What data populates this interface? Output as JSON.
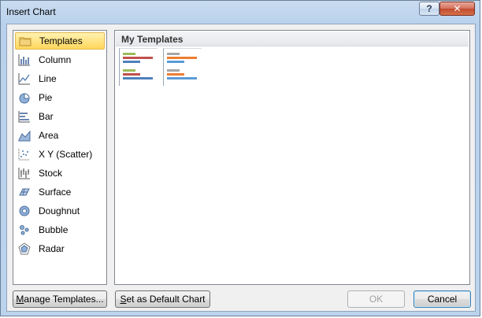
{
  "window": {
    "title": "Insert Chart",
    "help_label": "?",
    "close_label": "✕"
  },
  "chart_types": [
    {
      "label": "Templates",
      "icon": "folder-icon",
      "selected": true
    },
    {
      "label": "Column",
      "icon": "column-chart-icon"
    },
    {
      "label": "Line",
      "icon": "line-chart-icon"
    },
    {
      "label": "Pie",
      "icon": "pie-chart-icon"
    },
    {
      "label": "Bar",
      "icon": "bar-chart-icon"
    },
    {
      "label": "Area",
      "icon": "area-chart-icon"
    },
    {
      "label": "X Y (Scatter)",
      "icon": "scatter-chart-icon"
    },
    {
      "label": "Stock",
      "icon": "stock-chart-icon"
    },
    {
      "label": "Surface",
      "icon": "surface-chart-icon"
    },
    {
      "label": "Doughnut",
      "icon": "doughnut-chart-icon"
    },
    {
      "label": "Bubble",
      "icon": "bubble-chart-icon"
    },
    {
      "label": "Radar",
      "icon": "radar-chart-icon"
    }
  ],
  "templates_section": {
    "title": "My Templates",
    "templates": [
      {
        "name": "template-1",
        "colors": [
          "#9bbb59",
          "#c0504d",
          "#4f81bd"
        ]
      },
      {
        "name": "template-2",
        "colors": [
          "#a5a5a5",
          "#ed7d31",
          "#5b9bd5"
        ]
      }
    ]
  },
  "buttons": {
    "manage_prefix": "",
    "manage_mnemonic": "M",
    "manage_rest": "anage Templates...",
    "default_mnemonic": "S",
    "default_rest": "et as Default Chart",
    "ok": "OK",
    "cancel": "Cancel"
  },
  "colors": {
    "selection_fill": "#ffd65c",
    "selection_border": "#e3b74d"
  }
}
